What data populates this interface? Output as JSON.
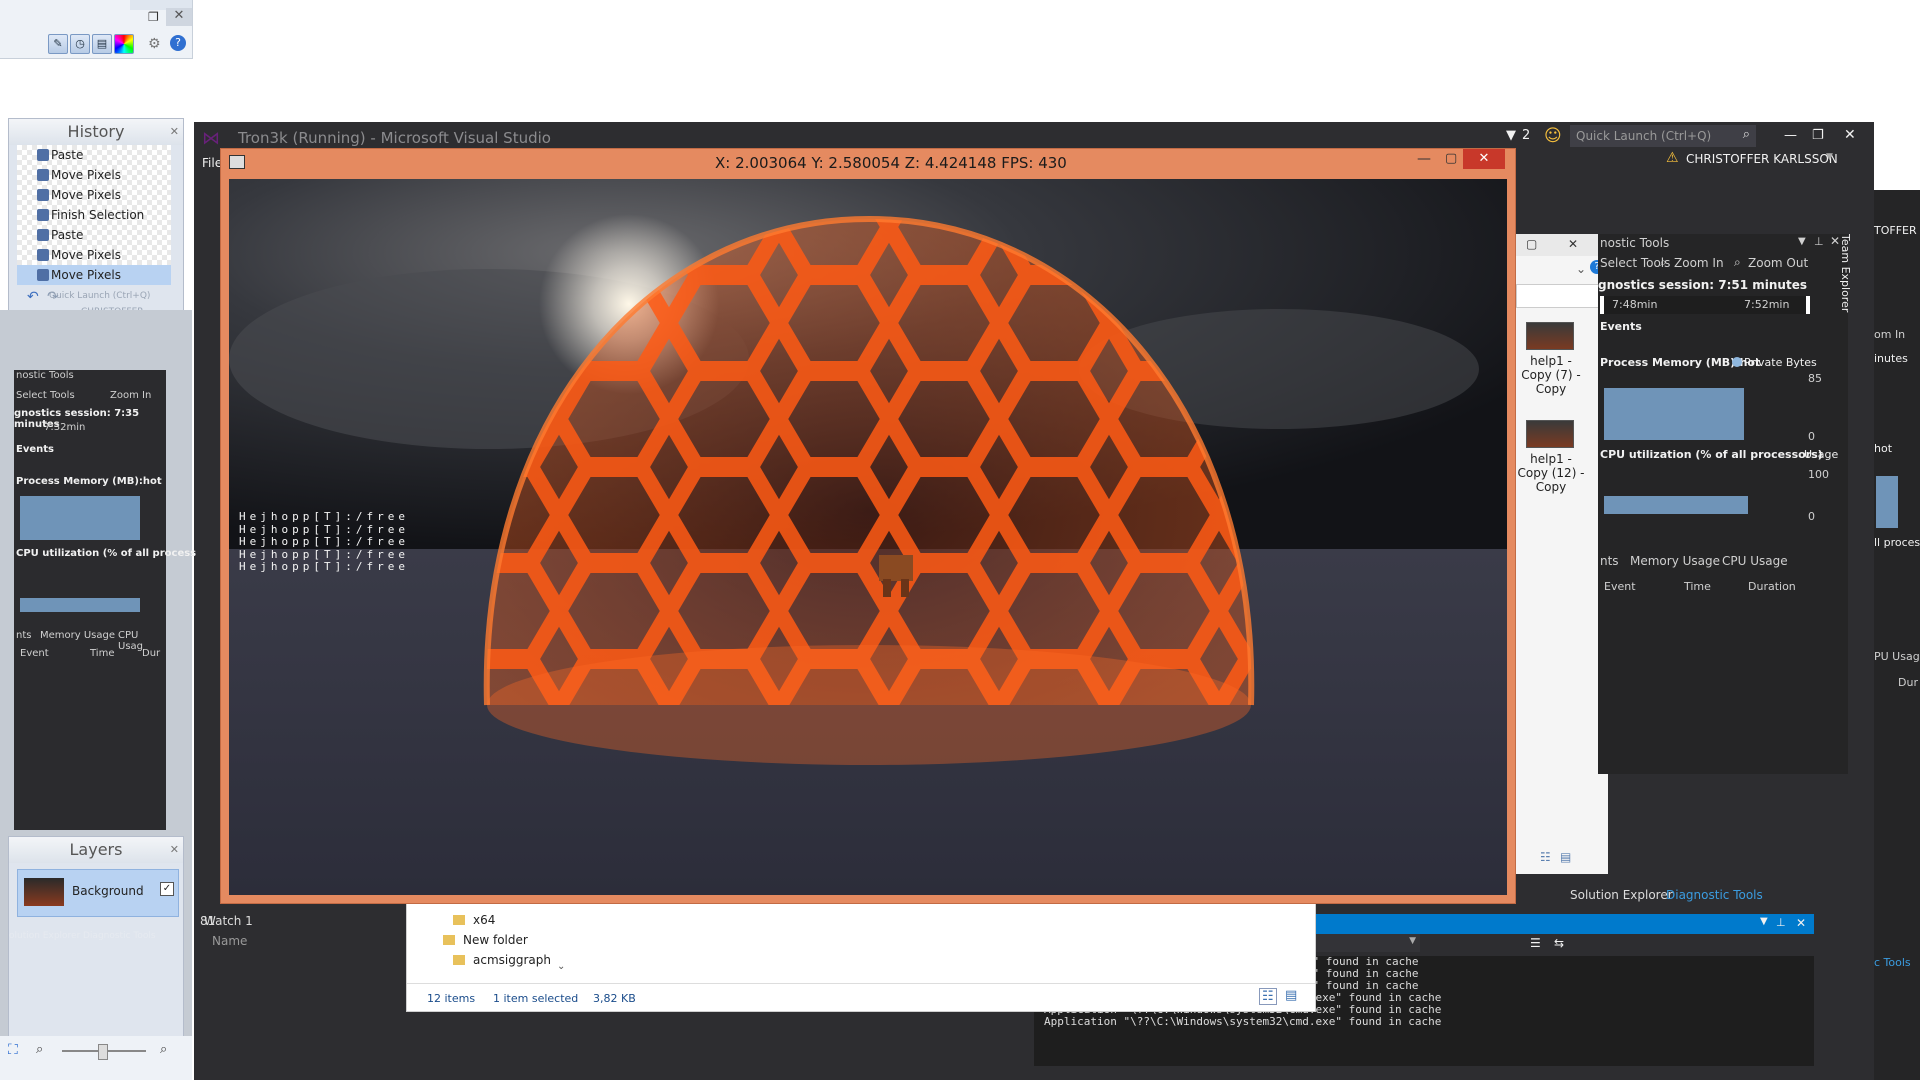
{
  "visual_studio": {
    "title": "Tron3k (Running) - Microsoft Visual Studio",
    "notification_count": "2",
    "quick_launch_placeholder": "Quick Launch (Ctrl+Q)",
    "user_name": "CHRISTOFFER KARLSSON",
    "file_menu": "File",
    "diag_panel": {
      "title": "nostic Tools",
      "select_tools": "Select Tools",
      "zoom_in": "Zoom In",
      "zoom_out": "Zoom Out",
      "session": "gnostics session: 7:51 minutes",
      "timeline_start": "7:48min",
      "timeline_end": "7:52min",
      "events_label": "Events",
      "memory_title": "Process Memory (MB):hot",
      "private_bytes": "Private Bytes",
      "memory_max": "85",
      "memory_min": "0",
      "cpu_title": "CPU utilization (% of all processors)",
      "usage_label": "Usage",
      "cpu_max": "100",
      "cpu_min": "0",
      "tab_events": "nts",
      "tab_memory": "Memory Usage",
      "tab_cpu": "CPU Usage",
      "col_event": "Event",
      "col_time": "Time",
      "col_duration": "Duration"
    },
    "bottom_tabs": {
      "solution_explorer": "Solution Explorer",
      "diagnostic_tools": "Diagnostic Tools"
    },
    "watch": {
      "title": "Watch 1",
      "col_name": "Name"
    },
    "line_ref": "81",
    "output_lines": [
      ".exe\" found in cache",
      ".exe\" found in cache",
      ".exe\" found in cache",
      "Application \"\\??\\C:\\Windows\\system32\\cmd.exe\" found in cache",
      "Application \"\\??\\C:\\Windows\\system32\\cmd.exe\" found in cache",
      "Application \"\\??\\C:\\Windows\\system32\\cmd.exe\" found in cache"
    ],
    "thumbs": [
      {
        "label": "help1 - Copy (7) - Copy"
      },
      {
        "label": "help1 - Copy (12) - Copy"
      }
    ],
    "team_explorer": "Team Explorer",
    "right_edge": {
      "user": "TOFFER K",
      "zoom": "om In",
      "minutes": "inutes",
      "hot": "hot",
      "process": "ll process",
      "usage": "PU Usage",
      "dur": "Dur",
      "tools": "c Tools"
    }
  },
  "paint_net": {
    "history_title": "History",
    "history_items": [
      {
        "label": "Paste",
        "selected": false
      },
      {
        "label": "Move Pixels",
        "selected": false
      },
      {
        "label": "Move Pixels",
        "selected": false
      },
      {
        "label": "Finish Selection",
        "selected": false
      },
      {
        "label": "Paste",
        "selected": false
      },
      {
        "label": "Move Pixels",
        "selected": false
      },
      {
        "label": "Move Pixels",
        "selected": true
      }
    ],
    "layers_title": "Layers",
    "layer_name": "Background",
    "bg_user": "CHRISTOFFER",
    "bg_quick": "Quick Launch (Ctrl+Q)"
  },
  "bg_diag": {
    "title": "nostic Tools",
    "select_tools": "Select Tools",
    "zoom_in": "Zoom In",
    "session": "gnostics session: 7:35 minutes",
    "timeline": "7:32min",
    "events": "Events",
    "memory": "Process Memory (MB):hot",
    "cpu": "CPU utilization (% of all process",
    "tab_events": "nts",
    "tab_memory": "Memory Usage",
    "tab_cpu": "CPU Usag",
    "col_event": "Event",
    "col_time": "Time",
    "col_dur": "Dur",
    "sol_explorer": "olution Explorer",
    "diag_tools": "Diagnostic Tools"
  },
  "game": {
    "hud": "X: 2.003064  Y: 2.580054  Z: 4.424148  FPS: 430",
    "chat_lines": [
      "Hejhopp[T]:/free",
      "Hejhopp[T]:/free",
      "Hejhopp[T]:/free",
      "Hejhopp[T]:/free",
      "Hejhopp[T]:/free"
    ]
  },
  "explorer": {
    "folders": [
      "x64",
      "New folder",
      "acmsiggraph"
    ],
    "item_count": "12 items",
    "selection": "1 item selected",
    "size": "3,82 KB"
  },
  "colors": {
    "vs_bg": "#2d2d30",
    "accent": "#007acc",
    "game_frame": "#e58a60",
    "dome": "#ff5a14"
  }
}
